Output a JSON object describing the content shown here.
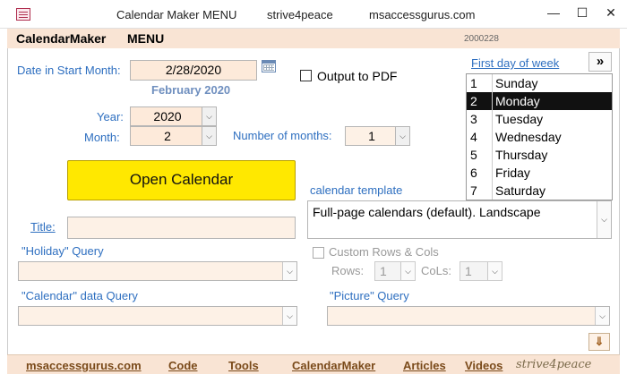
{
  "window": {
    "title": "Calendar Maker MENU",
    "title2": "strive4peace",
    "title3": "msaccessgurus.com",
    "min": "—",
    "max": "☐",
    "close": "✕"
  },
  "header": {
    "app_name": "CalendarMaker",
    "menu": "MENU",
    "version": "2000228"
  },
  "form": {
    "date_label": "Date in Start Month:",
    "date_value": "2/28/2020",
    "month_display": "February 2020",
    "output_pdf_label": "Output to PDF",
    "output_pdf_checked": false,
    "year_label": "Year:",
    "year_value": "2020",
    "month_label": "Month:",
    "month_value": "2",
    "num_months_label": "Number of months:",
    "num_months_value": "1",
    "open_calendar_label": "Open Calendar",
    "calendar_template_label": "calendar template",
    "calendar_template_value": "Full-page calendars (default). Landscape",
    "title_label": "Title:",
    "title_value": "",
    "holiday_label": "\"Holiday\" Query",
    "holiday_value": "",
    "calendar_data_label": "\"Calendar\" data Query",
    "calendar_data_value": "",
    "picture_label": "\"Picture\" Query",
    "picture_value": "",
    "custom_rows_label": "Custom Rows & Cols",
    "rows_label": "Rows:",
    "rows_value": "1",
    "cols_label": "CoLs:",
    "cols_value": "1",
    "first_day_label": "First day of week",
    "expand_button": "»",
    "scroll_down": "⇓",
    "first_day_items": [
      {
        "num": "1",
        "day": "Sunday"
      },
      {
        "num": "2",
        "day": "Monday"
      },
      {
        "num": "3",
        "day": "Tuesday"
      },
      {
        "num": "4",
        "day": "Wednesday"
      },
      {
        "num": "5",
        "day": "Thursday"
      },
      {
        "num": "6",
        "day": "Friday"
      },
      {
        "num": "7",
        "day": "Saturday"
      }
    ],
    "first_day_selected": "2"
  },
  "footer": {
    "links": [
      "msaccessgurus.com",
      "Code",
      "Tools",
      "CalendarMaker",
      "Articles",
      "Videos"
    ],
    "signature": "strive4peace"
  }
}
